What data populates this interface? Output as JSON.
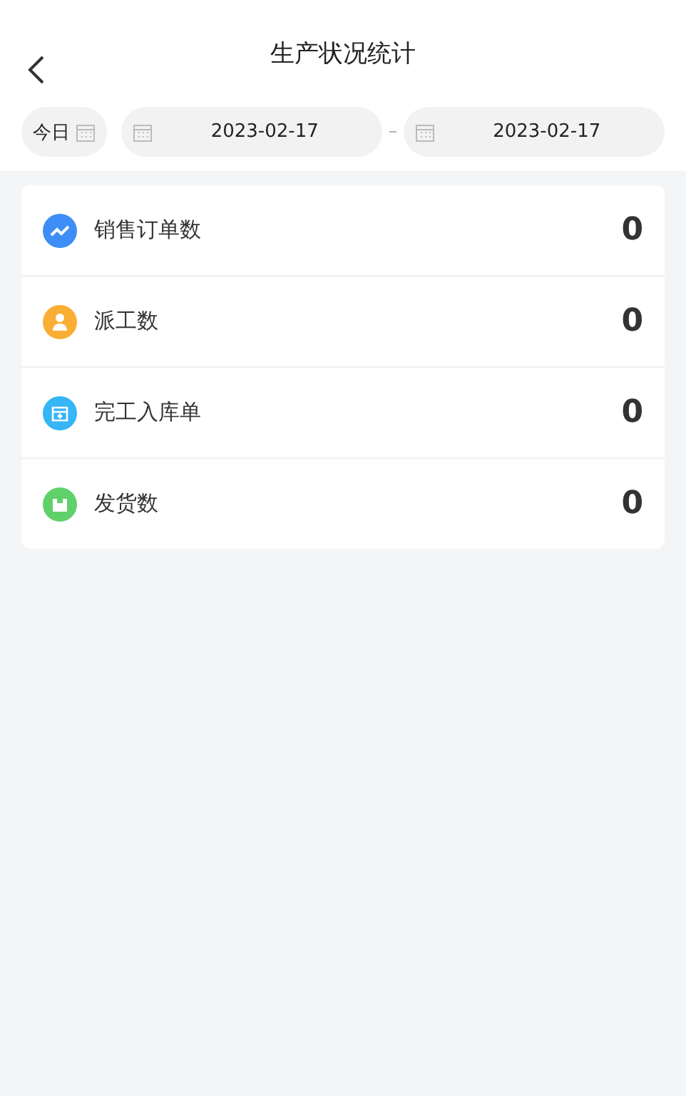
{
  "header": {
    "title": "生产状况统计"
  },
  "filter": {
    "today_label": "今日",
    "start_date": "2023-02-17",
    "separator": "–",
    "end_date": "2023-02-17"
  },
  "stats": [
    {
      "label": "销售订单数",
      "value": "0",
      "kind": "trend",
      "color": "#3d8ff7"
    },
    {
      "label": "派工数",
      "value": "0",
      "kind": "worker",
      "color": "#fbae34"
    },
    {
      "label": "完工入库单",
      "value": "0",
      "kind": "box",
      "color": "#36b5f7"
    },
    {
      "label": "发货数",
      "value": "0",
      "kind": "package",
      "color": "#60d16a"
    }
  ]
}
